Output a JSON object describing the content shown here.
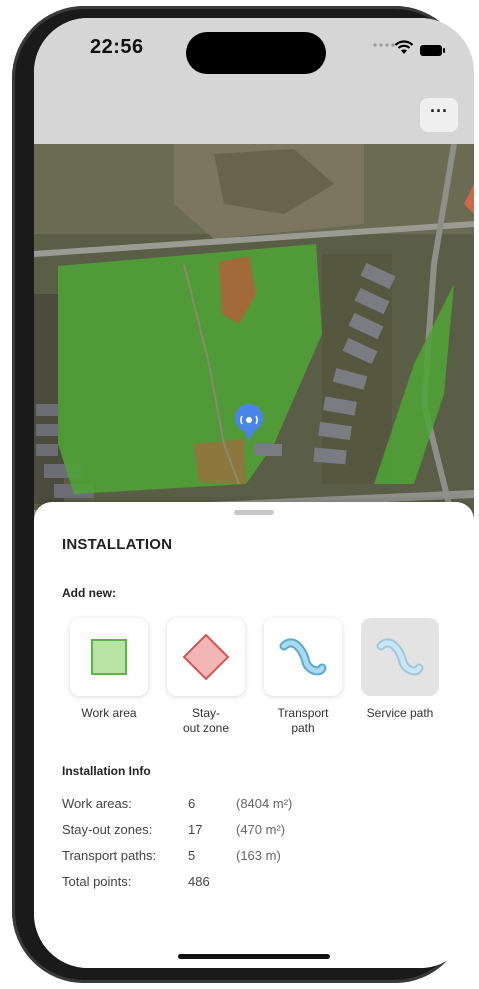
{
  "status_bar": {
    "time": "22:56"
  },
  "header": {
    "more_label": "···"
  },
  "sheet": {
    "title": "INSTALLATION",
    "add_new_label": "Add new:",
    "tools": [
      {
        "label": "Work area",
        "icon": "square-green-icon"
      },
      {
        "label": "Stay-\nout zone",
        "icon": "diamond-red-icon"
      },
      {
        "label": "Transport\npath",
        "icon": "path-blue-icon"
      },
      {
        "label": "Service path",
        "icon": "path-blue-faded-icon",
        "disabled": true
      }
    ],
    "info_title": "Installation Info",
    "info": [
      {
        "label": "Work areas:",
        "count": "6",
        "extent": "(8404 m²)"
      },
      {
        "label": "Stay-out zones:",
        "count": "17",
        "extent": "(470 m²)"
      },
      {
        "label": "Transport paths:",
        "count": "5",
        "extent": "(163 m)"
      },
      {
        "label": "Total points:",
        "count": "486",
        "extent": ""
      }
    ]
  },
  "colors": {
    "work_area": "#4caf50",
    "stay_out": "#e57373",
    "path": "#7fc6e6",
    "marker": "#4a86e8"
  }
}
